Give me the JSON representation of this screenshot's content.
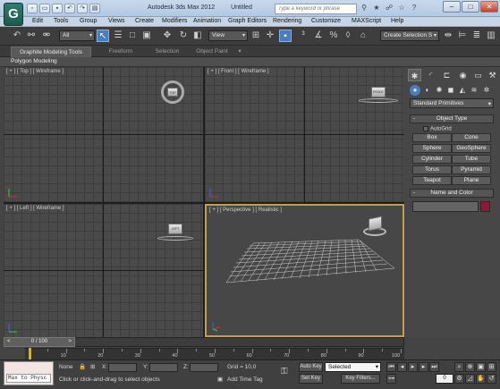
{
  "app": {
    "logo_glyph": "G",
    "product": "Autodesk 3ds Max 2012",
    "document": "Untitled",
    "search_placeholder": "Type a keyword or phrase"
  },
  "quick_access": [
    "new-icon",
    "open-icon",
    "save-icon",
    "undo-icon",
    "redo-icon",
    "project-icon"
  ],
  "window_controls": {
    "minimize": "–",
    "maximize": "□",
    "close": "✕"
  },
  "menu": [
    "Edit",
    "Tools",
    "Group",
    "Views",
    "Create",
    "Modifiers",
    "Animation",
    "Graph Editors",
    "Rendering",
    "Customize",
    "MAXScript",
    "Help"
  ],
  "toolbar": {
    "selection_filter": "All",
    "reference_coord": "View",
    "named_selection": "Create Selection S"
  },
  "ribbon": {
    "tabs": [
      "Graphite Modeling Tools",
      "Freeform",
      "Selection",
      "Object Paint"
    ],
    "active_tab": "Graphite Modeling Tools",
    "panel_label": "Polygon Modeling"
  },
  "viewports": {
    "top": {
      "label": "[ + ] [ Top ] [ Wireframe ]",
      "cube_text": "TOP"
    },
    "front": {
      "label": "[ + ] [ Front ] [ Wireframe ]",
      "cube_text": "FRONT"
    },
    "left": {
      "label": "[ + ] [ Left ] [ Wireframe ]",
      "cube_text": "LEFT"
    },
    "perspective": {
      "label": "[ + ] [ Perspective ] [ Realistic ]"
    }
  },
  "command_panel": {
    "category": "Standard Primitives",
    "object_type_title": "Object Type",
    "autogrid": "AutoGrid",
    "buttons": [
      "Box",
      "Cone",
      "Sphere",
      "GeoSphere",
      "Cylinder",
      "Tube",
      "Torus",
      "Pyramid",
      "Teapot",
      "Plane"
    ],
    "name_color_title": "Name and Color",
    "color": "#8b1a3a"
  },
  "timeline": {
    "frame_display": "0 / 100",
    "ticks": [
      "10",
      "20",
      "30",
      "40",
      "50",
      "60",
      "70",
      "80",
      "90",
      "100"
    ]
  },
  "status": {
    "maxscript_label": "Max to Physc",
    "selection": "None",
    "x_label": "X:",
    "y_label": "Y:",
    "z_label": "Z:",
    "grid": "Grid = 10,0",
    "prompt": "Click or click-and-drag to select objects",
    "add_time_tag": "Add Time Tag",
    "auto_key": "Auto Key",
    "set_key": "Set Key",
    "selected": "Selected",
    "key_filters": "Key Filters...",
    "frame": "0"
  }
}
